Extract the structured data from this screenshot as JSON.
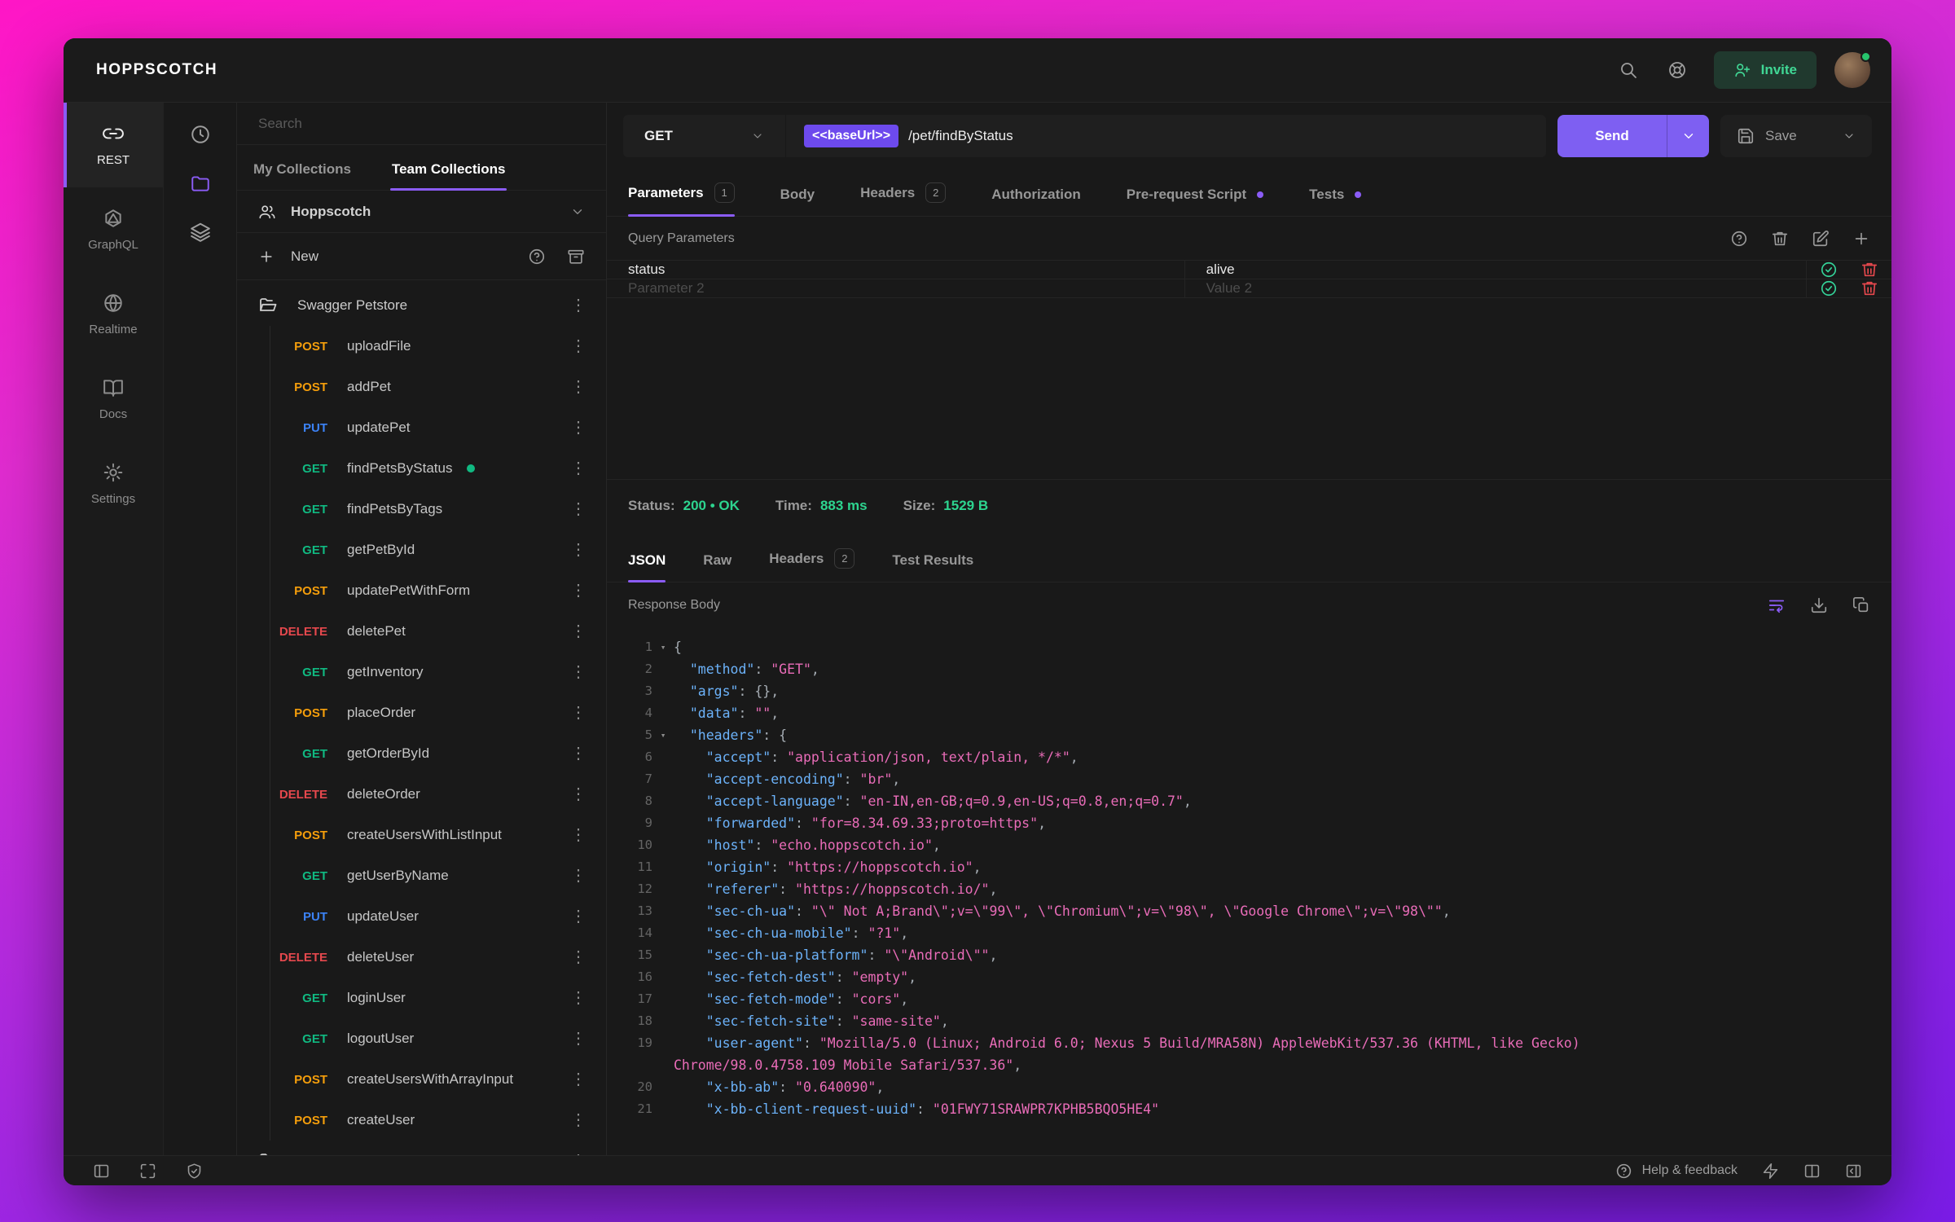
{
  "brand": "HOPPSCOTCH",
  "topbar": {
    "invite_label": "Invite"
  },
  "primary_nav": {
    "items": [
      {
        "label": "REST",
        "active": true
      },
      {
        "label": "GraphQL"
      },
      {
        "label": "Realtime"
      },
      {
        "label": "Docs"
      },
      {
        "label": "Settings"
      }
    ]
  },
  "collections": {
    "search_placeholder": "Search",
    "tabs": [
      {
        "label": "My Collections",
        "active": false
      },
      {
        "label": "Team Collections",
        "active": true
      }
    ],
    "team_name": "Hoppscotch",
    "new_label": "New",
    "folder_name": "Swagger Petstore",
    "requests": [
      {
        "method": "POST",
        "name": "uploadFile"
      },
      {
        "method": "POST",
        "name": "addPet"
      },
      {
        "method": "PUT",
        "name": "updatePet"
      },
      {
        "method": "GET",
        "name": "findPetsByStatus",
        "active": true
      },
      {
        "method": "GET",
        "name": "findPetsByTags"
      },
      {
        "method": "GET",
        "name": "getPetById"
      },
      {
        "method": "POST",
        "name": "updatePetWithForm"
      },
      {
        "method": "DELETE",
        "name": "deletePet"
      },
      {
        "method": "GET",
        "name": "getInventory"
      },
      {
        "method": "POST",
        "name": "placeOrder"
      },
      {
        "method": "GET",
        "name": "getOrderById"
      },
      {
        "method": "DELETE",
        "name": "deleteOrder"
      },
      {
        "method": "POST",
        "name": "createUsersWithListInput"
      },
      {
        "method": "GET",
        "name": "getUserByName"
      },
      {
        "method": "PUT",
        "name": "updateUser"
      },
      {
        "method": "DELETE",
        "name": "deleteUser"
      },
      {
        "method": "GET",
        "name": "loginUser"
      },
      {
        "method": "GET",
        "name": "logoutUser"
      },
      {
        "method": "POST",
        "name": "createUsersWithArrayInput"
      },
      {
        "method": "POST",
        "name": "createUser"
      }
    ],
    "has_partial_folder": true
  },
  "request": {
    "method": "GET",
    "url_env": "<<baseUrl>>",
    "url_path": "/pet/findByStatus",
    "send_label": "Send",
    "save_label": "Save",
    "tabs": [
      {
        "label": "Parameters",
        "badge": "1",
        "active": true
      },
      {
        "label": "Body"
      },
      {
        "label": "Headers",
        "badge": "2"
      },
      {
        "label": "Authorization"
      },
      {
        "label": "Pre-request Script",
        "dot": true
      },
      {
        "label": "Tests",
        "dot": true
      }
    ],
    "query_params_title": "Query Parameters",
    "param_rows": [
      {
        "key": "status",
        "value": "alive",
        "placeholder": false
      },
      {
        "key": "Parameter 2",
        "value": "Value 2",
        "placeholder": true
      }
    ]
  },
  "response": {
    "status_label": "Status:",
    "status_value": "200 • OK",
    "time_label": "Time:",
    "time_value": "883 ms",
    "size_label": "Size:",
    "size_value": "1529 B",
    "tabs": [
      {
        "label": "JSON",
        "active": true
      },
      {
        "label": "Raw"
      },
      {
        "label": "Headers",
        "badge": "2"
      },
      {
        "label": "Test Results"
      }
    ],
    "body_title": "Response Body",
    "code": [
      {
        "n": "1",
        "fold": true,
        "t": [
          [
            "p",
            "{"
          ]
        ]
      },
      {
        "n": "2",
        "t": [
          [
            "p",
            "  "
          ],
          [
            "k",
            "\"method\""
          ],
          [
            "p",
            ": "
          ],
          [
            "v",
            "\"GET\""
          ],
          [
            "p",
            ","
          ]
        ]
      },
      {
        "n": "3",
        "t": [
          [
            "p",
            "  "
          ],
          [
            "k",
            "\"args\""
          ],
          [
            "p",
            ": {},"
          ]
        ]
      },
      {
        "n": "4",
        "t": [
          [
            "p",
            "  "
          ],
          [
            "k",
            "\"data\""
          ],
          [
            "p",
            ": "
          ],
          [
            "v",
            "\"\""
          ],
          [
            "p",
            ","
          ]
        ]
      },
      {
        "n": "5",
        "fold": true,
        "t": [
          [
            "p",
            "  "
          ],
          [
            "k",
            "\"headers\""
          ],
          [
            "p",
            ": {"
          ]
        ]
      },
      {
        "n": "6",
        "t": [
          [
            "p",
            "    "
          ],
          [
            "k",
            "\"accept\""
          ],
          [
            "p",
            ": "
          ],
          [
            "v",
            "\"application/json, text/plain, */*\""
          ],
          [
            "p",
            ","
          ]
        ]
      },
      {
        "n": "7",
        "t": [
          [
            "p",
            "    "
          ],
          [
            "k",
            "\"accept-encoding\""
          ],
          [
            "p",
            ": "
          ],
          [
            "v",
            "\"br\""
          ],
          [
            "p",
            ","
          ]
        ]
      },
      {
        "n": "8",
        "t": [
          [
            "p",
            "    "
          ],
          [
            "k",
            "\"accept-language\""
          ],
          [
            "p",
            ": "
          ],
          [
            "v",
            "\"en-IN,en-GB;q=0.9,en-US;q=0.8,en;q=0.7\""
          ],
          [
            "p",
            ","
          ]
        ]
      },
      {
        "n": "9",
        "t": [
          [
            "p",
            "    "
          ],
          [
            "k",
            "\"forwarded\""
          ],
          [
            "p",
            ": "
          ],
          [
            "v",
            "\"for=8.34.69.33;proto=https\""
          ],
          [
            "p",
            ","
          ]
        ]
      },
      {
        "n": "10",
        "t": [
          [
            "p",
            "    "
          ],
          [
            "k",
            "\"host\""
          ],
          [
            "p",
            ": "
          ],
          [
            "v",
            "\"echo.hoppscotch.io\""
          ],
          [
            "p",
            ","
          ]
        ]
      },
      {
        "n": "11",
        "t": [
          [
            "p",
            "    "
          ],
          [
            "k",
            "\"origin\""
          ],
          [
            "p",
            ": "
          ],
          [
            "v",
            "\"https://hoppscotch.io\""
          ],
          [
            "p",
            ","
          ]
        ]
      },
      {
        "n": "12",
        "t": [
          [
            "p",
            "    "
          ],
          [
            "k",
            "\"referer\""
          ],
          [
            "p",
            ": "
          ],
          [
            "v",
            "\"https://hoppscotch.io/\""
          ],
          [
            "p",
            ","
          ]
        ]
      },
      {
        "n": "13",
        "t": [
          [
            "p",
            "    "
          ],
          [
            "k",
            "\"sec-ch-ua\""
          ],
          [
            "p",
            ": "
          ],
          [
            "v",
            "\"\\\" Not A;Brand\\\";v=\\\"99\\\", \\\"Chromium\\\";v=\\\"98\\\", \\\"Google Chrome\\\";v=\\\"98\\\"\""
          ],
          [
            "p",
            ","
          ]
        ]
      },
      {
        "n": "14",
        "t": [
          [
            "p",
            "    "
          ],
          [
            "k",
            "\"sec-ch-ua-mobile\""
          ],
          [
            "p",
            ": "
          ],
          [
            "v",
            "\"?1\""
          ],
          [
            "p",
            ","
          ]
        ]
      },
      {
        "n": "15",
        "t": [
          [
            "p",
            "    "
          ],
          [
            "k",
            "\"sec-ch-ua-platform\""
          ],
          [
            "p",
            ": "
          ],
          [
            "v",
            "\"\\\"Android\\\"\""
          ],
          [
            "p",
            ","
          ]
        ]
      },
      {
        "n": "16",
        "t": [
          [
            "p",
            "    "
          ],
          [
            "k",
            "\"sec-fetch-dest\""
          ],
          [
            "p",
            ": "
          ],
          [
            "v",
            "\"empty\""
          ],
          [
            "p",
            ","
          ]
        ]
      },
      {
        "n": "17",
        "t": [
          [
            "p",
            "    "
          ],
          [
            "k",
            "\"sec-fetch-mode\""
          ],
          [
            "p",
            ": "
          ],
          [
            "v",
            "\"cors\""
          ],
          [
            "p",
            ","
          ]
        ]
      },
      {
        "n": "18",
        "t": [
          [
            "p",
            "    "
          ],
          [
            "k",
            "\"sec-fetch-site\""
          ],
          [
            "p",
            ": "
          ],
          [
            "v",
            "\"same-site\""
          ],
          [
            "p",
            ","
          ]
        ]
      },
      {
        "n": "19",
        "t": [
          [
            "p",
            "    "
          ],
          [
            "k",
            "\"user-agent\""
          ],
          [
            "p",
            ": "
          ],
          [
            "v",
            "\"Mozilla/5.0 (Linux; Android 6.0; Nexus 5 Build/MRA58N) AppleWebKit/537.36 (KHTML, like Gecko)"
          ]
        ]
      },
      {
        "n": "",
        "t": [
          [
            "v",
            "Chrome/98.0.4758.109 Mobile Safari/537.36\""
          ],
          [
            "p",
            ","
          ]
        ]
      },
      {
        "n": "20",
        "t": [
          [
            "p",
            "    "
          ],
          [
            "k",
            "\"x-bb-ab\""
          ],
          [
            "p",
            ": "
          ],
          [
            "v",
            "\"0.640090\""
          ],
          [
            "p",
            ","
          ]
        ]
      },
      {
        "n": "21",
        "t": [
          [
            "p",
            "    "
          ],
          [
            "k",
            "\"x-bb-client-request-uuid\""
          ],
          [
            "p",
            ": "
          ],
          [
            "v",
            "\"01FWY71SRAWPR7KPHB5BQO5HE4\""
          ]
        ]
      }
    ]
  },
  "bottombar": {
    "help_label": "Help & feedback"
  },
  "colors": {
    "accent": "#8b5cf6",
    "get": "#10b981",
    "post": "#f59e0b",
    "put": "#3b82f6",
    "delete": "#e5484d",
    "success": "#2dd48f"
  }
}
